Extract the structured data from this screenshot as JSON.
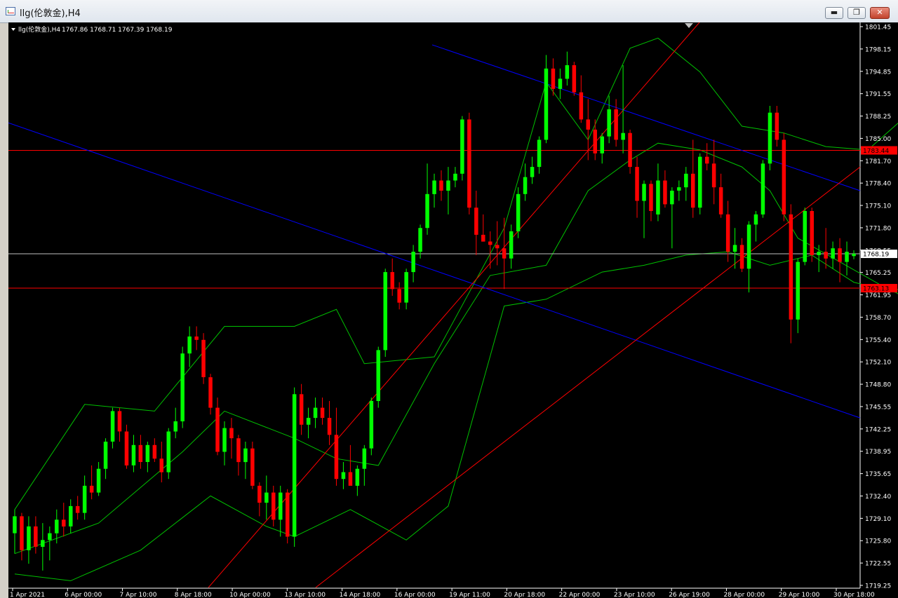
{
  "window": {
    "title": "llg(伦敦金),H4",
    "buttons": {
      "minimize": "▬",
      "restore": "❐",
      "close": "✕"
    }
  },
  "chart_info": {
    "symbol_label": "llg(伦敦金),H4",
    "ohlc": "1767.86 1768.71 1767.39 1768.19"
  },
  "colors": {
    "background": "#000000",
    "bull": "#00ff00",
    "bear": "#ff0000",
    "bollinger": "#00c000",
    "channel_blue": "#0000ff",
    "trend_red": "#ff0000",
    "level_red": "#ff0000",
    "price_line": "#c0c0c0",
    "axis_text": "#ffffff"
  },
  "chart_data": {
    "type": "candlestick",
    "title": "llg(伦敦金),H4",
    "ylim": [
      1718.9,
      1802.3
    ],
    "y_ticks": [
      "1801.45",
      "1798.15",
      "1794.85",
      "1791.55",
      "1788.25",
      "1785.00",
      "1781.70",
      "1778.40",
      "1775.10",
      "1771.80",
      "1768.55",
      "1765.25",
      "1761.95",
      "1758.70",
      "1755.40",
      "1752.10",
      "1748.80",
      "1745.55",
      "1742.25",
      "1738.95",
      "1735.65",
      "1732.40",
      "1729.10",
      "1725.80",
      "1722.55",
      "1719.25"
    ],
    "x_labels": [
      "1 Apr 2021",
      "6 Apr 00:00",
      "7 Apr 10:00",
      "8 Apr 18:00",
      "10 Apr 00:00",
      "13 Apr 10:00",
      "14 Apr 18:00",
      "16 Apr 00:00",
      "19 Apr 11:00",
      "20 Apr 18:00",
      "22 Apr 00:00",
      "23 Apr 10:00",
      "26 Apr 19:00",
      "28 Apr 00:00",
      "29 Apr 10:00",
      "30 Apr 18:00"
    ],
    "current_price": "1768.19",
    "levels": [
      {
        "price": 1783.44,
        "label": "1783.44"
      },
      {
        "price": 1763.13,
        "label": "1763.13"
      }
    ],
    "candles": [
      [
        1727.0,
        1730.5,
        1724.0,
        1729.5
      ],
      [
        1729.5,
        1730.0,
        1723.0,
        1724.5
      ],
      [
        1724.5,
        1729.5,
        1722.5,
        1728.0
      ],
      [
        1728.0,
        1729.5,
        1724.0,
        1725.0
      ],
      [
        1725.0,
        1728.5,
        1721.5,
        1726.0
      ],
      [
        1726.0,
        1728.0,
        1723.0,
        1727.0
      ],
      [
        1727.0,
        1730.5,
        1725.5,
        1729.0
      ],
      [
        1729.0,
        1731.5,
        1726.5,
        1728.0
      ],
      [
        1728.0,
        1732.0,
        1727.0,
        1731.0
      ],
      [
        1731.0,
        1732.5,
        1729.0,
        1730.0
      ],
      [
        1730.0,
        1735.5,
        1729.0,
        1734.0
      ],
      [
        1734.0,
        1737.0,
        1732.0,
        1733.0
      ],
      [
        1733.0,
        1737.5,
        1732.5,
        1736.5
      ],
      [
        1736.5,
        1741.0,
        1735.0,
        1740.5
      ],
      [
        1740.5,
        1745.5,
        1739.5,
        1745.0
      ],
      [
        1745.0,
        1745.5,
        1740.5,
        1742.0
      ],
      [
        1742.0,
        1743.0,
        1736.5,
        1737.0
      ],
      [
        1737.0,
        1741.5,
        1736.0,
        1740.0
      ],
      [
        1740.0,
        1741.5,
        1736.5,
        1737.5
      ],
      [
        1737.5,
        1740.5,
        1736.0,
        1740.0
      ],
      [
        1740.0,
        1741.0,
        1737.5,
        1738.0
      ],
      [
        1738.0,
        1740.5,
        1734.5,
        1736.0
      ],
      [
        1736.0,
        1742.5,
        1735.0,
        1742.0
      ],
      [
        1742.0,
        1745.5,
        1741.0,
        1743.5
      ],
      [
        1743.5,
        1754.5,
        1742.5,
        1753.5
      ],
      [
        1753.5,
        1757.5,
        1751.5,
        1756.0
      ],
      [
        1756.0,
        1757.5,
        1754.0,
        1755.5
      ],
      [
        1755.5,
        1756.5,
        1749.0,
        1750.0
      ],
      [
        1750.0,
        1750.5,
        1744.5,
        1745.5
      ],
      [
        1745.5,
        1747.0,
        1738.5,
        1739.0
      ],
      [
        1739.0,
        1743.5,
        1737.0,
        1742.5
      ],
      [
        1742.5,
        1744.0,
        1738.0,
        1741.0
      ],
      [
        1741.0,
        1741.5,
        1735.5,
        1737.5
      ],
      [
        1737.5,
        1740.5,
        1735.0,
        1739.5
      ],
      [
        1739.5,
        1740.5,
        1733.5,
        1734.0
      ],
      [
        1734.0,
        1734.5,
        1729.5,
        1731.5
      ],
      [
        1731.5,
        1735.5,
        1729.0,
        1733.0
      ],
      [
        1733.0,
        1734.0,
        1728.0,
        1729.0
      ],
      [
        1729.0,
        1734.0,
        1726.5,
        1733.0
      ],
      [
        1733.0,
        1733.5,
        1725.5,
        1726.5
      ],
      [
        1726.5,
        1748.5,
        1725.0,
        1747.5
      ],
      [
        1747.5,
        1749.0,
        1741.5,
        1743.0
      ],
      [
        1743.0,
        1745.5,
        1741.0,
        1744.0
      ],
      [
        1744.0,
        1747.0,
        1742.5,
        1745.5
      ],
      [
        1745.5,
        1747.0,
        1743.0,
        1744.0
      ],
      [
        1744.0,
        1746.5,
        1740.0,
        1741.5
      ],
      [
        1741.5,
        1745.5,
        1734.0,
        1735.0
      ],
      [
        1735.0,
        1737.5,
        1733.5,
        1736.0
      ],
      [
        1736.0,
        1740.0,
        1734.5,
        1734.0
      ],
      [
        1734.0,
        1737.0,
        1732.5,
        1736.5
      ],
      [
        1736.5,
        1740.0,
        1734.0,
        1739.5
      ],
      [
        1739.5,
        1747.0,
        1738.5,
        1746.5
      ],
      [
        1746.5,
        1754.5,
        1745.5,
        1754.0
      ],
      [
        1754.0,
        1766.0,
        1753.0,
        1765.5
      ],
      [
        1765.5,
        1767.5,
        1762.0,
        1763.0
      ],
      [
        1763.0,
        1764.0,
        1760.0,
        1761.0
      ],
      [
        1761.0,
        1766.0,
        1760.0,
        1765.5
      ],
      [
        1765.5,
        1769.5,
        1764.0,
        1768.5
      ],
      [
        1768.5,
        1772.5,
        1767.5,
        1772.0
      ],
      [
        1772.0,
        1781.5,
        1771.0,
        1777.0
      ],
      [
        1777.0,
        1780.0,
        1775.0,
        1779.0
      ],
      [
        1779.0,
        1780.5,
        1776.0,
        1777.5
      ],
      [
        1777.5,
        1781.0,
        1774.0,
        1779.0
      ],
      [
        1779.0,
        1781.0,
        1778.0,
        1780.0
      ],
      [
        1780.0,
        1788.5,
        1779.0,
        1788.0
      ],
      [
        1788.0,
        1789.0,
        1774.0,
        1775.0
      ],
      [
        1775.0,
        1777.5,
        1768.0,
        1771.0
      ],
      [
        1771.0,
        1774.0,
        1770.0,
        1770.0
      ],
      [
        1770.0,
        1771.5,
        1766.0,
        1769.5
      ],
      [
        1769.5,
        1773.0,
        1766.5,
        1769.0
      ],
      [
        1769.0,
        1773.5,
        1763.0,
        1767.5
      ],
      [
        1767.5,
        1772.5,
        1766.0,
        1771.5
      ],
      [
        1771.5,
        1778.0,
        1770.5,
        1777.0
      ],
      [
        1777.0,
        1781.5,
        1776.0,
        1779.5
      ],
      [
        1779.5,
        1782.5,
        1778.5,
        1781.0
      ],
      [
        1781.0,
        1785.5,
        1780.0,
        1785.0
      ],
      [
        1785.0,
        1797.5,
        1784.5,
        1795.5
      ],
      [
        1795.5,
        1797.0,
        1791.5,
        1792.5
      ],
      [
        1792.5,
        1795.5,
        1791.0,
        1794.0
      ],
      [
        1794.0,
        1798.0,
        1793.0,
        1796.0
      ],
      [
        1796.0,
        1796.5,
        1791.5,
        1792.0
      ],
      [
        1792.0,
        1794.5,
        1787.5,
        1788.0
      ],
      [
        1788.0,
        1791.0,
        1782.0,
        1786.5
      ],
      [
        1786.5,
        1788.0,
        1782.0,
        1783.0
      ],
      [
        1783.0,
        1786.0,
        1781.5,
        1785.5
      ],
      [
        1785.5,
        1791.5,
        1784.5,
        1789.5
      ],
      [
        1789.5,
        1791.0,
        1784.0,
        1785.0
      ],
      [
        1785.0,
        1796.0,
        1783.0,
        1786.0
      ],
      [
        1786.0,
        1786.5,
        1780.0,
        1781.0
      ],
      [
        1781.0,
        1782.5,
        1773.5,
        1776.0
      ],
      [
        1776.0,
        1779.0,
        1770.5,
        1778.5
      ],
      [
        1778.5,
        1779.0,
        1773.0,
        1774.5
      ],
      [
        1774.0,
        1781.5,
        1773.0,
        1779.0
      ],
      [
        1779.0,
        1780.5,
        1775.0,
        1775.5
      ],
      [
        1775.5,
        1778.0,
        1769.0,
        1777.5
      ],
      [
        1777.5,
        1779.0,
        1776.0,
        1778.0
      ],
      [
        1778.0,
        1781.0,
        1776.0,
        1780.0
      ],
      [
        1780.0,
        1785.0,
        1773.5,
        1775.0
      ],
      [
        1775.0,
        1783.0,
        1774.0,
        1782.5
      ],
      [
        1782.5,
        1784.5,
        1780.5,
        1781.5
      ],
      [
        1781.5,
        1785.0,
        1775.5,
        1778.0
      ],
      [
        1778.0,
        1780.0,
        1773.5,
        1774.0
      ],
      [
        1774.0,
        1776.0,
        1767.0,
        1768.5
      ],
      [
        1768.5,
        1772.0,
        1766.0,
        1769.5
      ],
      [
        1769.5,
        1770.5,
        1765.5,
        1766.0
      ],
      [
        1766.0,
        1773.0,
        1762.5,
        1772.5
      ],
      [
        1772.5,
        1774.5,
        1770.0,
        1774.0
      ],
      [
        1774.0,
        1782.0,
        1773.5,
        1781.5
      ],
      [
        1781.5,
        1790.0,
        1780.5,
        1789.0
      ],
      [
        1789.0,
        1790.0,
        1784.0,
        1785.0
      ],
      [
        1785.0,
        1786.0,
        1773.0,
        1774.0
      ],
      [
        1774.0,
        1775.5,
        1755.0,
        1758.5
      ],
      [
        1758.5,
        1767.5,
        1756.5,
        1767.0
      ],
      [
        1767.0,
        1775.0,
        1766.5,
        1774.5
      ],
      [
        1774.5,
        1775.0,
        1767.0,
        1768.0
      ],
      [
        1768.0,
        1769.5,
        1765.5,
        1768.5
      ],
      [
        1768.5,
        1772.0,
        1766.0,
        1767.5
      ],
      [
        1767.5,
        1770.0,
        1766.0,
        1769.0
      ],
      [
        1769.0,
        1770.5,
        1764.0,
        1767.0
      ],
      [
        1767.0,
        1770.0,
        1765.0,
        1768.5
      ],
      [
        1767.86,
        1768.71,
        1767.39,
        1768.19
      ]
    ],
    "bollinger": {
      "mid": [
        [
          0,
          1724.0
        ],
        [
          12,
          1728.5
        ],
        [
          24,
          1739.0
        ],
        [
          30,
          1745.0
        ],
        [
          40,
          1741.0
        ],
        [
          46,
          1738.0
        ],
        [
          52,
          1737.0
        ],
        [
          60,
          1752.0
        ],
        [
          68,
          1765.0
        ],
        [
          76,
          1766.5
        ],
        [
          82,
          1777.5
        ],
        [
          88,
          1782.0
        ],
        [
          92,
          1784.5
        ],
        [
          98,
          1783.5
        ],
        [
          104,
          1781.0
        ],
        [
          108,
          1777.5
        ],
        [
          112,
          1770.5
        ],
        [
          118,
          1767.0
        ],
        [
          124,
          1763.5
        ],
        [
          128,
          1762.5
        ],
        [
          134,
          1764.0
        ],
        [
          140,
          1766.5
        ],
        [
          146,
          1772.0
        ],
        [
          150,
          1773.0
        ]
      ],
      "upper": [
        [
          0,
          1730.5
        ],
        [
          10,
          1746.0
        ],
        [
          20,
          1745.0
        ],
        [
          30,
          1757.5
        ],
        [
          40,
          1757.5
        ],
        [
          46,
          1760.0
        ],
        [
          50,
          1752.0
        ],
        [
          60,
          1753.0
        ],
        [
          70,
          1772.0
        ],
        [
          76,
          1793.5
        ],
        [
          82,
          1785.0
        ],
        [
          88,
          1798.5
        ],
        [
          92,
          1800.0
        ],
        [
          98,
          1795.0
        ],
        [
          104,
          1787.0
        ],
        [
          110,
          1786.0
        ],
        [
          116,
          1784.0
        ],
        [
          122,
          1783.5
        ],
        [
          128,
          1789.0
        ],
        [
          134,
          1787.5
        ],
        [
          138,
          1784.5
        ],
        [
          142,
          1779.5
        ],
        [
          146,
          1774.5
        ],
        [
          150,
          1772.0
        ]
      ],
      "lower": [
        [
          0,
          1721.0
        ],
        [
          8,
          1720.0
        ],
        [
          18,
          1724.5
        ],
        [
          28,
          1732.5
        ],
        [
          36,
          1728.0
        ],
        [
          40,
          1726.5
        ],
        [
          48,
          1730.5
        ],
        [
          56,
          1726.0
        ],
        [
          62,
          1731.0
        ],
        [
          70,
          1760.5
        ],
        [
          76,
          1761.5
        ],
        [
          84,
          1765.5
        ],
        [
          90,
          1766.5
        ],
        [
          96,
          1768.0
        ],
        [
          102,
          1768.5
        ],
        [
          108,
          1766.5
        ],
        [
          114,
          1768.0
        ],
        [
          120,
          1764.0
        ],
        [
          126,
          1762.5
        ],
        [
          130,
          1760.0
        ],
        [
          134,
          1759.0
        ],
        [
          140,
          1757.0
        ],
        [
          146,
          1755.0
        ],
        [
          150,
          1754.5
        ]
      ]
    },
    "blue_channel": [
      {
        "x1": 0,
        "y1": 1787.5,
        "x2": 1214,
        "y2": 1744.0
      },
      {
        "x1": 604,
        "y1": 1799.0,
        "x2": 1214,
        "y2": 1777.5
      }
    ],
    "red_trend": [
      {
        "x1": 285,
        "y1": 1719.0,
        "x2": 985,
        "y2": 1802.3
      },
      {
        "x1": 438,
        "y1": 1719.0,
        "x2": 1214,
        "y2": 1781.0
      }
    ]
  }
}
